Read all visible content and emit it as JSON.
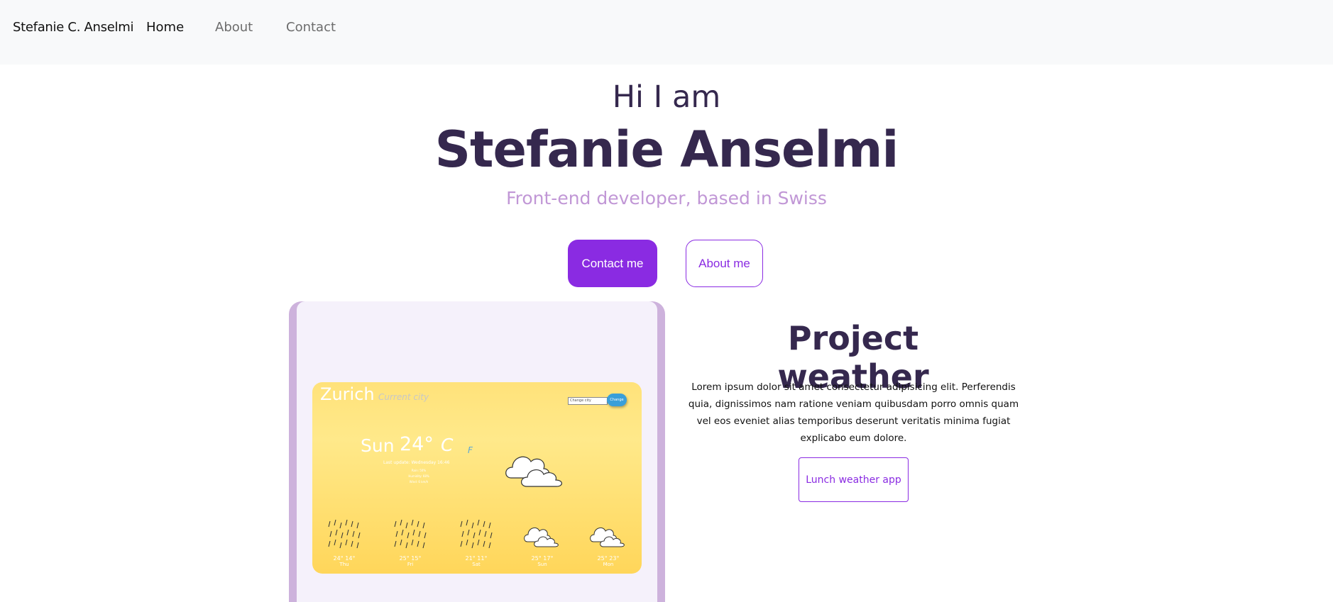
{
  "nav": {
    "brand": "Stefanie C. Anselmi",
    "home": "Home",
    "about": "About",
    "contact": "Contact"
  },
  "hero": {
    "greeting": "Hi I am",
    "name": "Stefanie Anselmi",
    "subtitle": "Front-end developer, based in Swiss",
    "contact_button": "Contact me",
    "about_button": "About me"
  },
  "project": {
    "title": "Project weather",
    "description": "Lorem ipsum dolor sit amet consectetur adipisicing elit. Perferendis quia, dignissimos nam ratione veniam quibusdam porro omnis quam vel eos eveniet alias temporibus deserunt veritatis minima fugiat explicabo eum dolore.",
    "button": "Lunch weather app"
  },
  "weather_preview": {
    "city": "Zurich",
    "current_city_label": "Current city",
    "search_placeholder": "Change city",
    "search_button": "Change",
    "day": "Sun",
    "temperature": "24°",
    "unit_c": "C",
    "unit_f": "F",
    "last_update": "Last update: Wednesday 16:46",
    "details": [
      "Rain: 50%",
      "Humidity: 68%",
      "Wind: 6 km/h"
    ],
    "forecast": [
      {
        "day": "Thu",
        "temp": "24° 14°",
        "icon": "rain-icon"
      },
      {
        "day": "Fri",
        "temp": "25° 15°",
        "icon": "rain-icon"
      },
      {
        "day": "Sat",
        "temp": "21° 11°",
        "icon": "rain-icon"
      },
      {
        "day": "Sun",
        "temp": "25° 17°",
        "icon": "cloud-icon"
      },
      {
        "day": "Mon",
        "temp": "25° 23°",
        "icon": "cloud-icon"
      }
    ]
  },
  "colors": {
    "accent": "#8a2be2",
    "heading": "#35284e",
    "subtitle": "#c197d6",
    "frame": "#cdb2dc"
  }
}
